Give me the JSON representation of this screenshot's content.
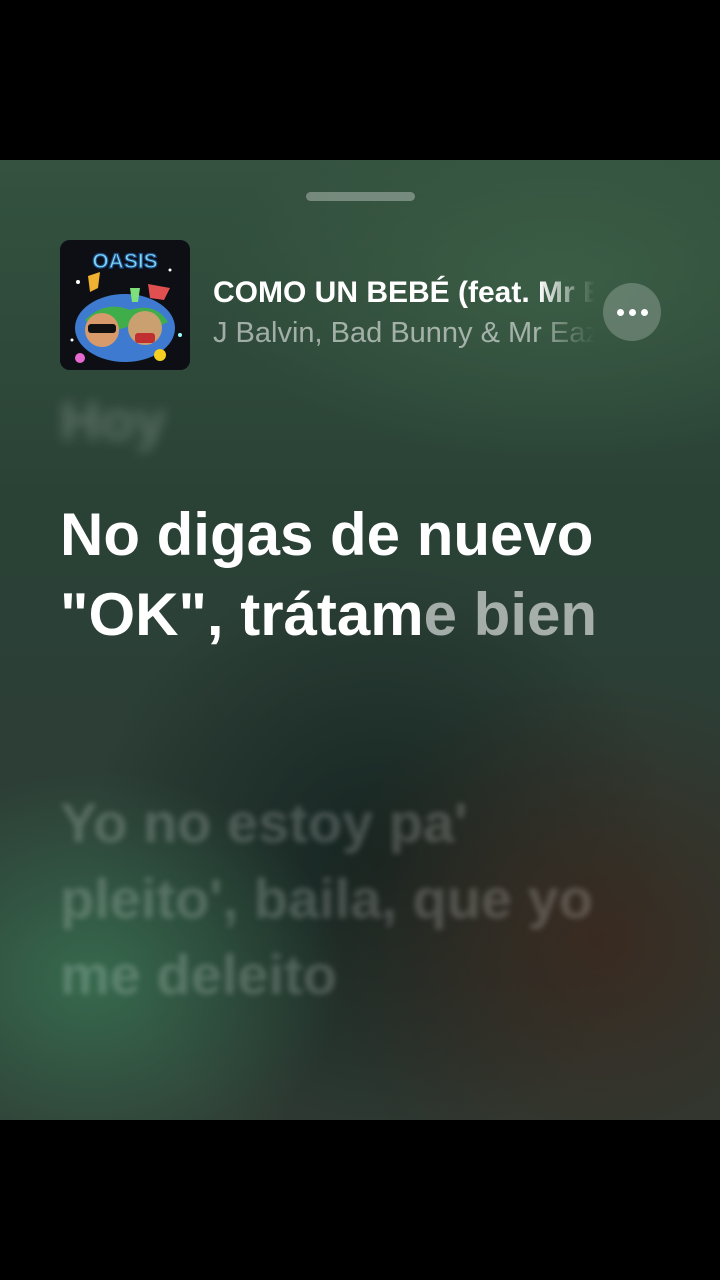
{
  "track": {
    "title": "COMO UN BEBÉ (feat. Mr Eazi)",
    "artists": "J Balvin, Bad Bunny & Mr Eazi",
    "album_art_text": "OASIS"
  },
  "controls": {
    "more_icon": "ellipsis-icon"
  },
  "lyrics": {
    "previous_line": "Hoy",
    "current_sung": "No digas de nuevo \"OK\", trátam",
    "current_unsung": "e bien",
    "next_line": "Yo no estoy pa' pleito', baila, que yo me deleito"
  },
  "colors": {
    "background_top": "#34523f",
    "background_bottom": "#2f3a33",
    "lyric_active": "#ffffff"
  }
}
